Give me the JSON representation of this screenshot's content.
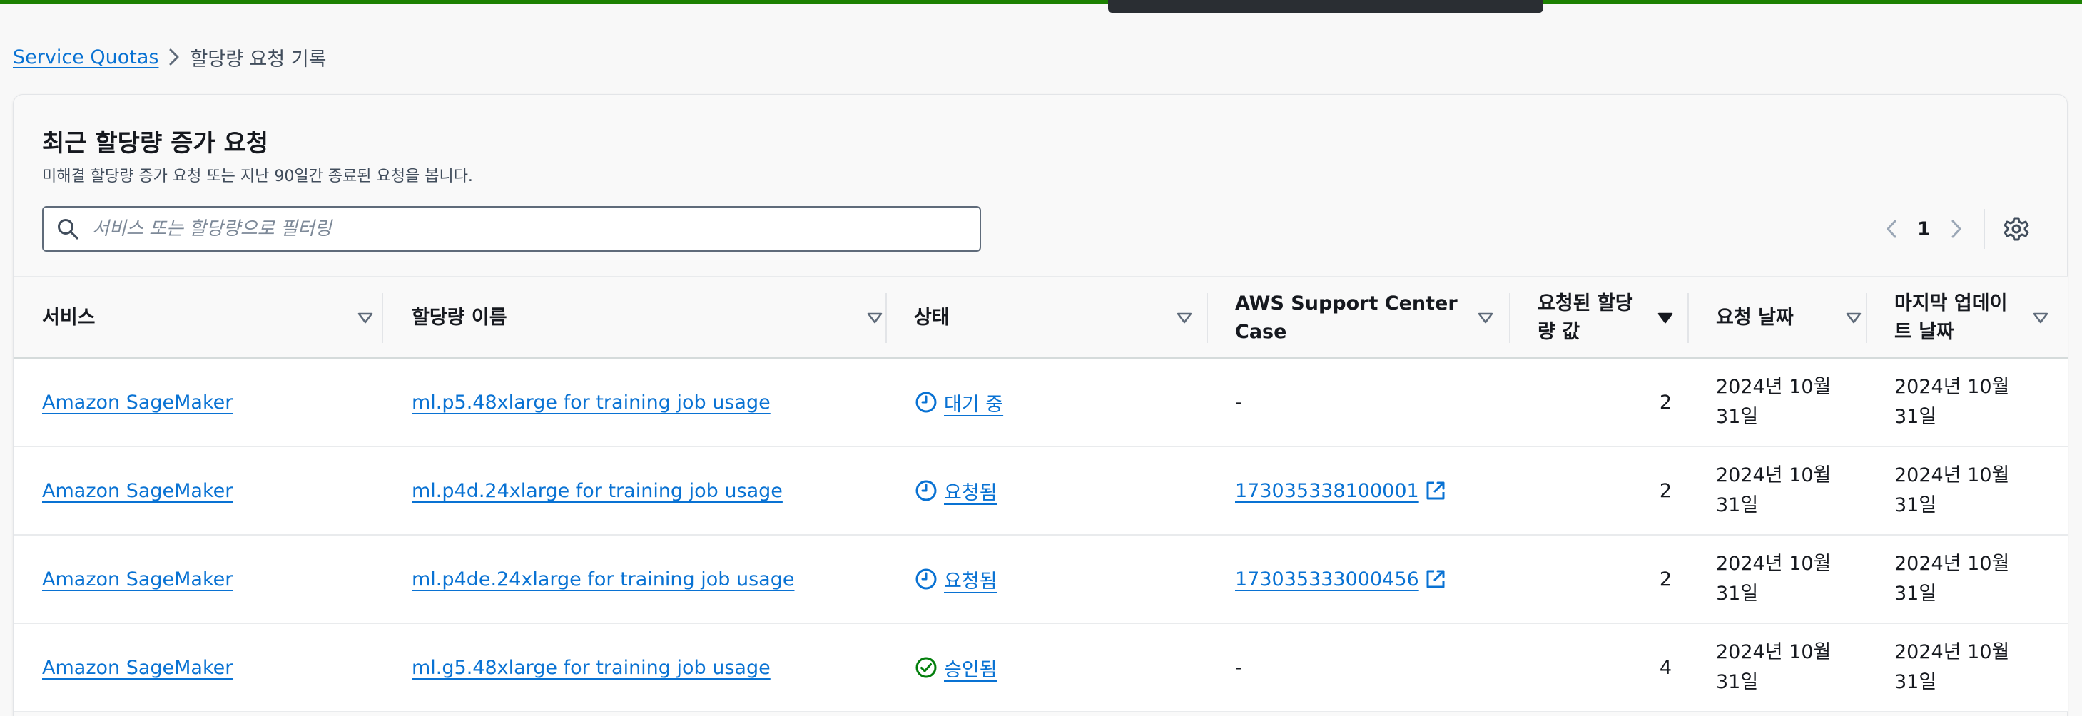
{
  "colors": {
    "accent": "#0972d3",
    "top_bar": "#1d8102",
    "success": "#037f0c",
    "pending": "#0972d3"
  },
  "breadcrumb": {
    "root": "Service Quotas",
    "current": "할당량 요청 기록"
  },
  "panel": {
    "title": "최근 할당량 증가 요청",
    "description": "미해결 할당량 증가 요청 또는 지난 90일간 종료된 요청을 봅니다."
  },
  "search": {
    "placeholder": "서비스 또는 할당량으로 필터링",
    "value": ""
  },
  "pagination": {
    "current_page": "1"
  },
  "table": {
    "columns": [
      {
        "label": "서비스",
        "sort": "sortable"
      },
      {
        "label": "할당량 이름",
        "sort": "sortable"
      },
      {
        "label": "상태",
        "sort": "sortable"
      },
      {
        "label": "AWS Support Center Case",
        "sort": "sortable"
      },
      {
        "label": "요청된 할당량 값",
        "sort": "descending"
      },
      {
        "label": "요청 날짜",
        "sort": "sortable"
      },
      {
        "label": "마지막 업데이트 날짜",
        "sort": "sortable"
      }
    ],
    "rows": [
      {
        "service": "Amazon SageMaker",
        "quota": "ml.p5.48xlarge for training job usage",
        "status": "대기 중",
        "status_icon": "clock-icon",
        "case": "-",
        "requested": "2",
        "request_date": "2024년 10월 31일",
        "updated": "2024년 10월 31일"
      },
      {
        "service": "Amazon SageMaker",
        "quota": "ml.p4d.24xlarge for training job usage",
        "status": "요청됨",
        "status_icon": "clock-icon",
        "case": "173035338100001",
        "requested": "2",
        "request_date": "2024년 10월 31일",
        "updated": "2024년 10월 31일"
      },
      {
        "service": "Amazon SageMaker",
        "quota": "ml.p4de.24xlarge for training job usage",
        "status": "요청됨",
        "status_icon": "clock-icon",
        "case": "173035333000456",
        "requested": "2",
        "request_date": "2024년 10월 31일",
        "updated": "2024년 10월 31일"
      },
      {
        "service": "Amazon SageMaker",
        "quota": "ml.g5.48xlarge for training job usage",
        "status": "승인됨",
        "status_icon": "check-circle-icon",
        "case": "-",
        "requested": "4",
        "request_date": "2024년 10월 31일",
        "updated": "2024년 10월 31일"
      }
    ]
  }
}
